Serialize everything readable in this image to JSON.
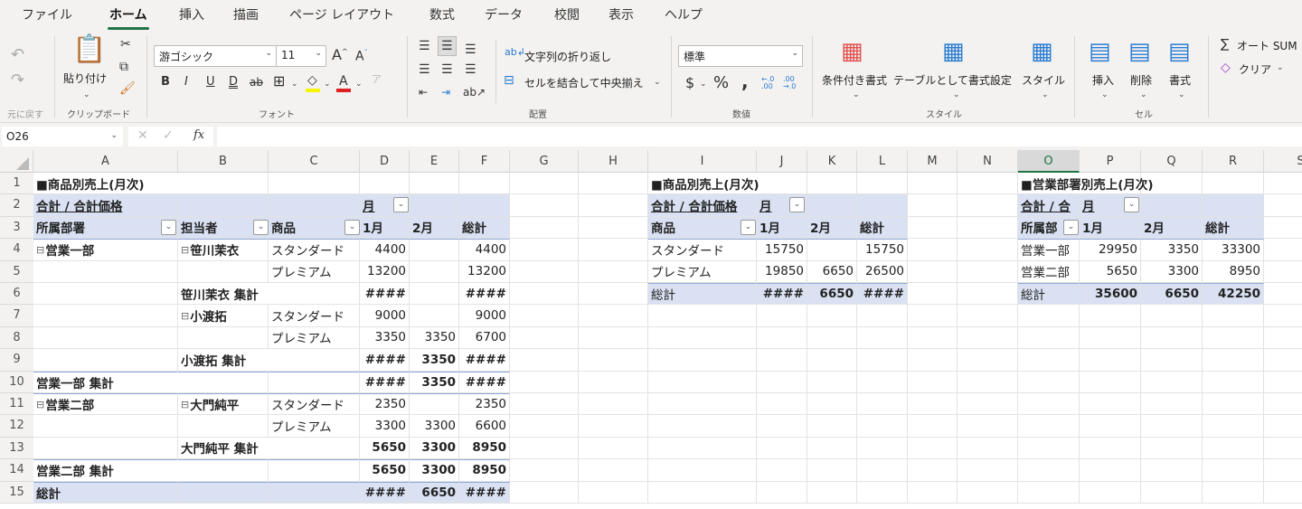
{
  "menu_tabs": [
    "ファイル",
    "ホーム",
    "挿入",
    "描画",
    "ページ レイアウト",
    "数式",
    "データ",
    "校閲",
    "表示",
    "ヘルプ"
  ],
  "active_tab": "ホーム",
  "ribbon": {
    "undo_group": "元に戻す",
    "clipboard": {
      "paste": "貼り付け",
      "group": "クリップボード"
    },
    "font": {
      "name": "游ゴシック",
      "size": "11",
      "group": "フォント",
      "bold": "B",
      "italic": "I",
      "underline": "U",
      "double_underline": "D",
      "strike": "ab",
      "grow": "A",
      "shrink": "A",
      "font_color": "A",
      "fill_color": "#f5f500",
      "text_color": "#e02020"
    },
    "alignment": {
      "wrap": "文字列の折り返し",
      "merge": "セルを結合して中央揃え",
      "group": "配置"
    },
    "number": {
      "format": "標準",
      "currency": "$",
      "percent": "%",
      "comma": ",",
      "inc_decimal": "←.0 .00",
      "dec_decimal": ".00 →.0",
      "group": "数値"
    },
    "styles": {
      "conditional": "条件付き書式",
      "table": "テーブルとして書式設定",
      "cell_styles": "スタイル",
      "group": "スタイル"
    },
    "cells": {
      "insert": "挿入",
      "delete": "削除",
      "format": "書式",
      "group": "セル"
    },
    "editing": {
      "autosum": "オート SUM",
      "clear": "クリア"
    }
  },
  "formula_bar": {
    "name_box": "O26",
    "fx": "fx",
    "formula": ""
  },
  "columns": [
    "A",
    "B",
    "C",
    "D",
    "E",
    "F",
    "G",
    "H",
    "I",
    "J",
    "K",
    "L",
    "M",
    "N",
    "O",
    "P",
    "Q",
    "R",
    "S"
  ],
  "selected_column": "O",
  "row_numbers": [
    "1",
    "2",
    "3",
    "4",
    "5",
    "6",
    "7",
    "8",
    "9",
    "10",
    "11",
    "12",
    "13",
    "14",
    "15"
  ],
  "sheet": {
    "rows": [
      [
        "■商品別売上(月次)",
        "",
        "",
        "",
        "",
        "",
        "",
        "",
        "■商品別売上(月次)",
        "",
        "",
        "",
        "",
        "",
        "■営業部署別売上(月次)",
        "",
        "",
        "",
        ""
      ],
      [
        "合計 / 合計価格",
        "",
        "",
        "月",
        "",
        "",
        "",
        "",
        "合計 / 合計価格",
        "月",
        "",
        "",
        "",
        "",
        "合計 / 合",
        "月",
        "",
        "",
        ""
      ],
      [
        "所属部署",
        "担当者",
        "商品",
        "1月",
        "2月",
        "総計",
        "",
        "",
        "商品",
        "1月",
        "2月",
        "総計",
        "",
        "",
        "所属部",
        "1月",
        "2月",
        "総計",
        ""
      ],
      [
        "営業一部",
        "笹川茉衣",
        "スタンダード",
        "4400",
        "",
        "4400",
        "",
        "",
        "スタンダード",
        "15750",
        "",
        "15750",
        "",
        "",
        "営業一部",
        "29950",
        "3350",
        "33300",
        ""
      ],
      [
        "",
        "",
        "プレミアム",
        "13200",
        "",
        "13200",
        "",
        "",
        "プレミアム",
        "19850",
        "6650",
        "26500",
        "",
        "",
        "営業二部",
        "5650",
        "3300",
        "8950",
        ""
      ],
      [
        "",
        "笹川茉衣 集計",
        "",
        "####",
        "",
        "####",
        "",
        "",
        "総計",
        "####",
        "6650",
        "####",
        "",
        "",
        "総計",
        "35600",
        "6650",
        "42250",
        ""
      ],
      [
        "",
        "小渡拓",
        "スタンダード",
        "9000",
        "",
        "9000",
        "",
        "",
        "",
        "",
        "",
        "",
        "",
        "",
        "",
        "",
        "",
        "",
        ""
      ],
      [
        "",
        "",
        "プレミアム",
        "3350",
        "3350",
        "6700",
        "",
        "",
        "",
        "",
        "",
        "",
        "",
        "",
        "",
        "",
        "",
        "",
        ""
      ],
      [
        "",
        "小渡拓 集計",
        "",
        "####",
        "3350",
        "####",
        "",
        "",
        "",
        "",
        "",
        "",
        "",
        "",
        "",
        "",
        "",
        "",
        ""
      ],
      [
        "営業一部 集計",
        "",
        "",
        "####",
        "3350",
        "####",
        "",
        "",
        "",
        "",
        "",
        "",
        "",
        "",
        "",
        "",
        "",
        "",
        ""
      ],
      [
        "営業二部",
        "大門純平",
        "スタンダード",
        "2350",
        "",
        "2350",
        "",
        "",
        "",
        "",
        "",
        "",
        "",
        "",
        "",
        "",
        "",
        "",
        ""
      ],
      [
        "",
        "",
        "プレミアム",
        "3300",
        "3300",
        "6600",
        "",
        "",
        "",
        "",
        "",
        "",
        "",
        "",
        "",
        "",
        "",
        "",
        ""
      ],
      [
        "",
        "大門純平 集計",
        "",
        "5650",
        "3300",
        "8950",
        "",
        "",
        "",
        "",
        "",
        "",
        "",
        "",
        "",
        "",
        "",
        "",
        ""
      ],
      [
        "営業二部 集計",
        "",
        "",
        "5650",
        "3300",
        "8950",
        "",
        "",
        "",
        "",
        "",
        "",
        "",
        "",
        "",
        "",
        "",
        "",
        ""
      ],
      [
        "総計",
        "",
        "",
        "####",
        "6650",
        "####",
        "",
        "",
        "",
        "",
        "",
        "",
        "",
        "",
        "",
        "",
        "",
        "",
        ""
      ]
    ]
  }
}
